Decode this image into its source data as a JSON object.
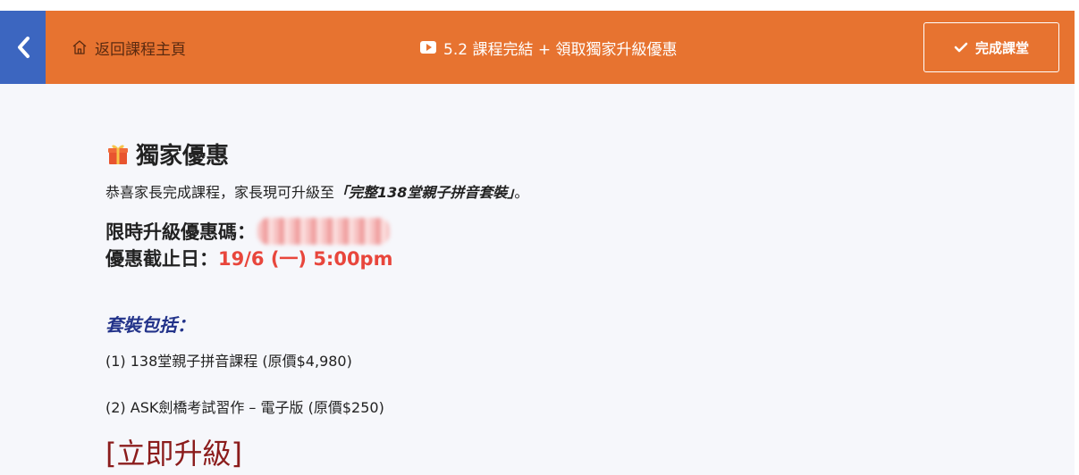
{
  "header": {
    "back_icon": "chevron-left-icon",
    "home_icon": "home-icon",
    "home_label": "返回課程主頁",
    "lesson_icon": "video-play-icon",
    "lesson_title": "5.2 課程完結 + 領取獨家升級優惠",
    "complete_icon": "check-icon",
    "complete_label": "完成課堂",
    "colors": {
      "bar": "#e77330",
      "back": "#3c66c0"
    }
  },
  "content": {
    "title_icon": "gift-icon",
    "title": "獨家優惠",
    "congrats_prefix": "恭喜家長完成課程，家長現可升級至",
    "package_name": "「完整138堂親子拼音套裝」",
    "congrats_suffix": "。",
    "code_label": "限時升級優惠碼：",
    "deadline_label": "優惠截止日：",
    "deadline_value": "19/6 (一) 5:00pm",
    "includes_title": "套裝包括：",
    "items": [
      "(1) 138堂親子拼音課程 (原價$4,980)",
      "(2) ASK劍橋考試習作 – 電子版 (原價$250)"
    ],
    "upgrade_link": "[立即升級]"
  }
}
